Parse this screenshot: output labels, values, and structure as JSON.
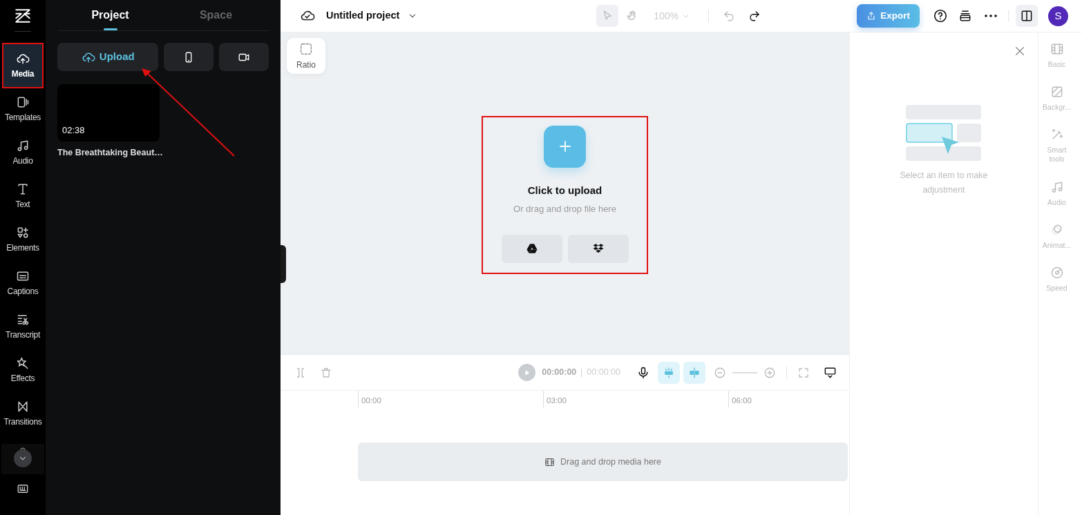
{
  "rail": {
    "items": [
      {
        "label": "Media",
        "kind": "cloud",
        "selected": true,
        "highlighted": true
      },
      {
        "label": "Templates",
        "kind": "template",
        "selected": false,
        "highlighted": false
      },
      {
        "label": "Audio",
        "kind": "music",
        "selected": false,
        "highlighted": false
      },
      {
        "label": "Text",
        "kind": "text",
        "selected": false,
        "highlighted": false
      },
      {
        "label": "Elements",
        "kind": "shapes",
        "selected": false,
        "highlighted": false
      },
      {
        "label": "Captions",
        "kind": "caption",
        "selected": false,
        "highlighted": false
      },
      {
        "label": "Transcript",
        "kind": "transcript",
        "selected": false,
        "highlighted": false
      },
      {
        "label": "Effects",
        "kind": "star",
        "selected": false,
        "highlighted": false
      },
      {
        "label": "Transitions",
        "kind": "bowtie",
        "selected": false,
        "highlighted": false
      }
    ]
  },
  "panel": {
    "tabs": [
      {
        "label": "Project",
        "selected": true
      },
      {
        "label": "Space",
        "selected": false
      }
    ],
    "upload_button": "Upload",
    "annotation_arrow": true,
    "media": [
      {
        "duration": "02:38",
        "title": "The Breathtaking Beaut…"
      }
    ]
  },
  "header": {
    "project_title": "Untitled project",
    "zoom": "100%",
    "export": "Export",
    "avatar": "S"
  },
  "canvas": {
    "ratio": "Ratio",
    "upload": {
      "title": "Click to upload",
      "subtitle": "Or drag and drop file here",
      "highlighted": true
    }
  },
  "timeline": {
    "time_current": "00:00:00",
    "time_total": "00:00:00",
    "ruler": [
      "00:00",
      "03:00",
      "06:00"
    ],
    "drop_hint": "Drag and drop media here"
  },
  "inspector": {
    "empty_text": "Select an item to make adjustment",
    "tabs": [
      {
        "label": "Basic",
        "kind": "film"
      },
      {
        "label": "Backgr...",
        "kind": "hatch"
      },
      {
        "label": "Smart tools",
        "kind": "wand"
      },
      {
        "label": "Audio",
        "kind": "music"
      },
      {
        "label": "Animat...",
        "kind": "ring"
      },
      {
        "label": "Speed",
        "kind": "gauge"
      }
    ]
  }
}
